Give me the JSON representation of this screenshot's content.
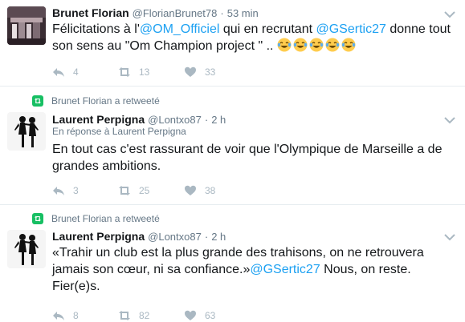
{
  "tweets": [
    {
      "name": "Brunet Florian",
      "handle": "@FlorianBrunet78",
      "time": "53 min",
      "text_prefix": "Félicitations à l'",
      "mention1": "@OM_Officiel",
      "text_mid": " qui en recrutant ",
      "mention2": "@GSertic27",
      "text_suffix": " donne tout son sens au \"Om Champion project \" ..",
      "emoji_name": "face-with-tears-of-joy",
      "reply_count": "4",
      "retweet_count": "13",
      "like_count": "33"
    },
    {
      "retweet_context": "Brunet Florian a retweeté",
      "name": "Laurent Perpigna",
      "handle": "@Lontxo87",
      "time": "2 h",
      "reply_to": "En réponse à Laurent Perpigna",
      "text": "En tout cas c'est rassurant de voir que l'Olympique de Marseille a de grandes ambitions.",
      "reply_count": "3",
      "retweet_count": "25",
      "like_count": "38"
    },
    {
      "retweet_context": "Brunet Florian a retweeté",
      "name": "Laurent Perpigna",
      "handle": "@Lontxo87",
      "time": "2 h",
      "text_prefix": "«Trahir un club est la plus grande des trahisons, on ne retrouvera jamais son cœur, ni sa confiance.»",
      "mention": "@GSertic27",
      "text_suffix": " Nous, on reste. Fier(e)s.",
      "reply_count": "8",
      "retweet_count": "82",
      "like_count": "63"
    }
  ],
  "colors": {
    "link": "#1da1f2",
    "muted": "#657786",
    "icon": "#aab8c2",
    "retweet_green": "#17bf63"
  },
  "icons": [
    "reply-icon",
    "retweet-icon",
    "heart-icon",
    "chevron-down-icon",
    "retweet-badge-icon"
  ]
}
